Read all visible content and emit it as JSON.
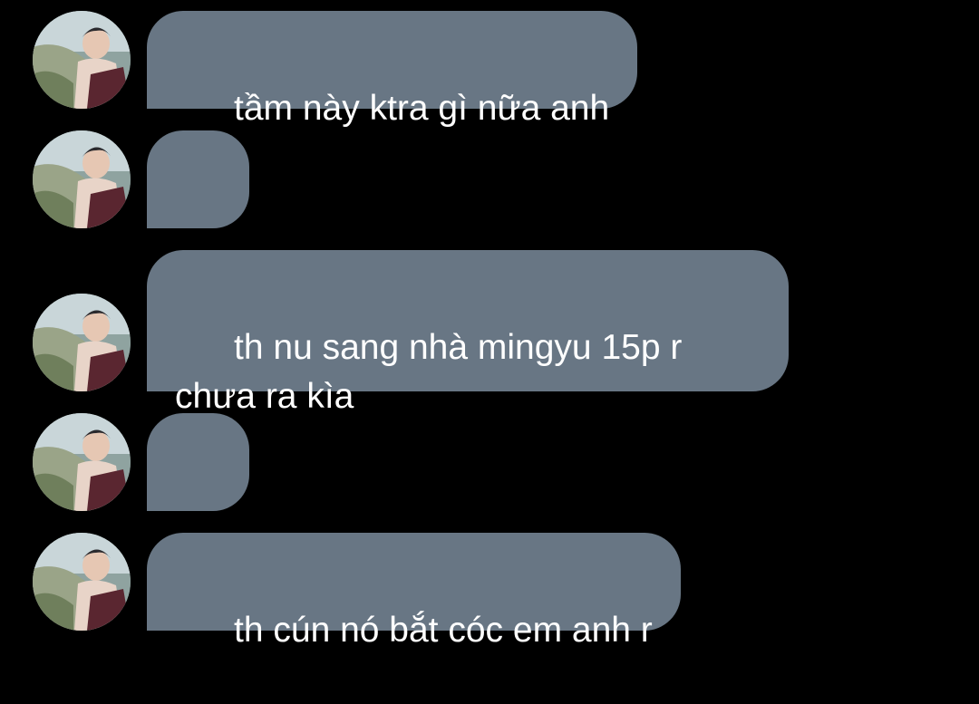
{
  "colors": {
    "background": "#000000",
    "bubble": "#687684",
    "text": "#ffffff"
  },
  "messages": [
    {
      "type": "text",
      "text": "tầm này ktra gì nữa anh"
    },
    {
      "type": "emoji",
      "icon": "slightly-smiling-face-icon"
    },
    {
      "type": "text",
      "text": "th nu sang nhà mingyu 15p r chưa ra kìa"
    },
    {
      "type": "emoji",
      "icon": "thumbs-up-icon"
    },
    {
      "type": "text",
      "text": "th cún nó bắt cóc em anh r"
    }
  ]
}
